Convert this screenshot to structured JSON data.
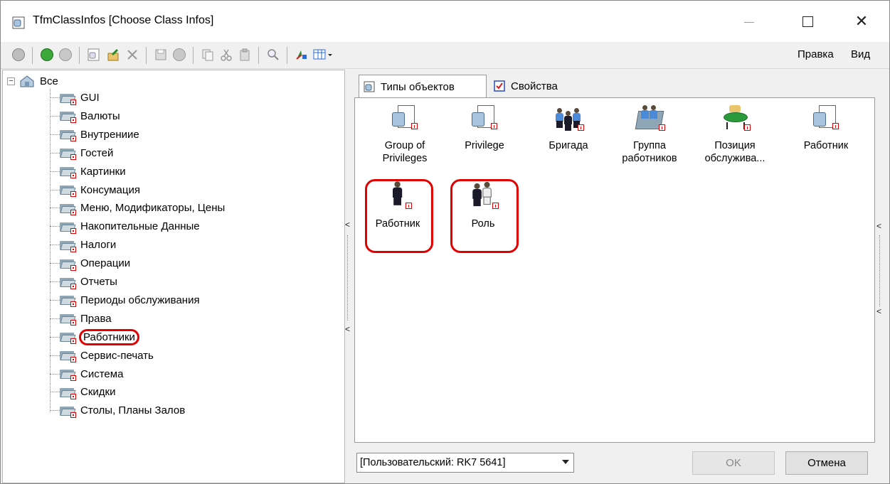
{
  "window": {
    "title": "TfmClassInfos [Choose Class Infos]",
    "controls": {
      "minimize": "—",
      "maximize": "☐",
      "close": "✕"
    }
  },
  "toolbar": {
    "menus": {
      "edit": "Правка",
      "view": "Вид"
    },
    "icons": [
      "refresh-icon",
      "back-icon",
      "forward-icon",
      "new-object-icon",
      "export-icon",
      "delete-icon",
      "save-icon",
      "undo-icon",
      "copy-icon",
      "cut-icon",
      "paste-icon",
      "find-icon",
      "sort-icon",
      "view-grid-icon"
    ]
  },
  "tree": {
    "root_label": "Все",
    "expander": "⊟",
    "items": [
      "GUI",
      "Валюты",
      "Внутрениие",
      "Гостей",
      "Картинки",
      "Консумация",
      "Меню, Модификаторы, Цены",
      "Накопительные Данные",
      "Налоги",
      "Операции",
      "Отчеты",
      "Периоды обслуживания",
      "Права",
      "Работники",
      "Сервис-печать",
      "Система",
      "Скидки",
      "Столы, Планы Залов"
    ],
    "highlighted_item": "Работники"
  },
  "tabs": [
    {
      "label": "Типы объектов",
      "active": true
    },
    {
      "label": "Свойства",
      "active": false
    }
  ],
  "objects": [
    {
      "label_line1": "Group of",
      "label_line2": "Privileges",
      "icon": "cube-doc-icon"
    },
    {
      "label_line1": "Privilege",
      "label_line2": "",
      "icon": "cube-doc-icon"
    },
    {
      "label_line1": "Бригада",
      "label_line2": "",
      "icon": "team-icon"
    },
    {
      "label_line1": "Группа",
      "label_line2": "работников",
      "icon": "workers-folder-icon"
    },
    {
      "label_line1": "Позиция",
      "label_line2": "обслужива...",
      "icon": "service-table-icon"
    },
    {
      "label_line1": "Работник",
      "label_line2": "",
      "icon": "cube-doc-icon"
    },
    {
      "label_line1": "Работник",
      "label_line2": "",
      "icon": "worker-icon",
      "highlighted": true
    },
    {
      "label_line1": "Роль",
      "label_line2": "",
      "icon": "role-icon",
      "highlighted": true
    }
  ],
  "footer": {
    "combo_value": "[Пользовательский: RK7 5641]",
    "ok_label": "OK",
    "cancel_label": "Отмена"
  },
  "colors": {
    "highlight_red": "#e00000",
    "selection_blue": "#4a8ad8"
  }
}
